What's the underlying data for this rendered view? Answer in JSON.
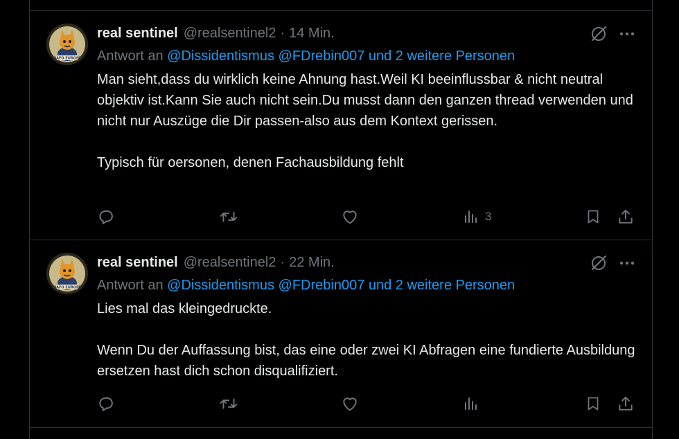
{
  "tweets": [
    {
      "display_name": "real sentinel",
      "handle": "@realsentinel2",
      "separator": "·",
      "time": "14 Min.",
      "reply_prefix": "Antwort an",
      "reply_mentions": "@Dissidentismus @FDrebin007 und 2 weitere Personen",
      "paragraphs": [
        "Man sieht,dass du wirklich keine Ahnung hast.Weil KI beeinflussbar & nicht neutral objektiv ist.Kann Sie auch nicht sein.Du musst dann den ganzen thread verwenden und nicht nur Auszüge die Dir passen-also aus dem Kontext gerissen.",
        "Typisch für oersonen, denen Fachausbildung fehlt"
      ],
      "view_count": "3",
      "avatar_text": "NAFO EUROPE"
    },
    {
      "display_name": "real sentinel",
      "handle": "@realsentinel2",
      "separator": "·",
      "time": "22 Min.",
      "reply_prefix": "Antwort an",
      "reply_mentions": "@Dissidentismus @FDrebin007 und 2 weitere Personen",
      "paragraphs": [
        "Lies mal das kleingedruckte.",
        "Wenn Du der Auffassung bist, das eine oder zwei KI Abfragen eine fundierte Ausbildung ersetzen hast dich schon disqualifiziert."
      ],
      "view_count": "",
      "avatar_text": "NAFO EUROPE"
    }
  ],
  "icons": {
    "reply": "reply-icon",
    "repost": "repost-icon",
    "like": "heart-icon",
    "views": "views-icon",
    "bookmark": "bookmark-icon",
    "share": "share-icon",
    "grok": "grok-icon",
    "more": "more-icon"
  },
  "colors": {
    "background": "#000000",
    "text": "#e7e9ea",
    "muted": "#71767b",
    "link": "#1d9bf0",
    "border": "#2f3336"
  }
}
